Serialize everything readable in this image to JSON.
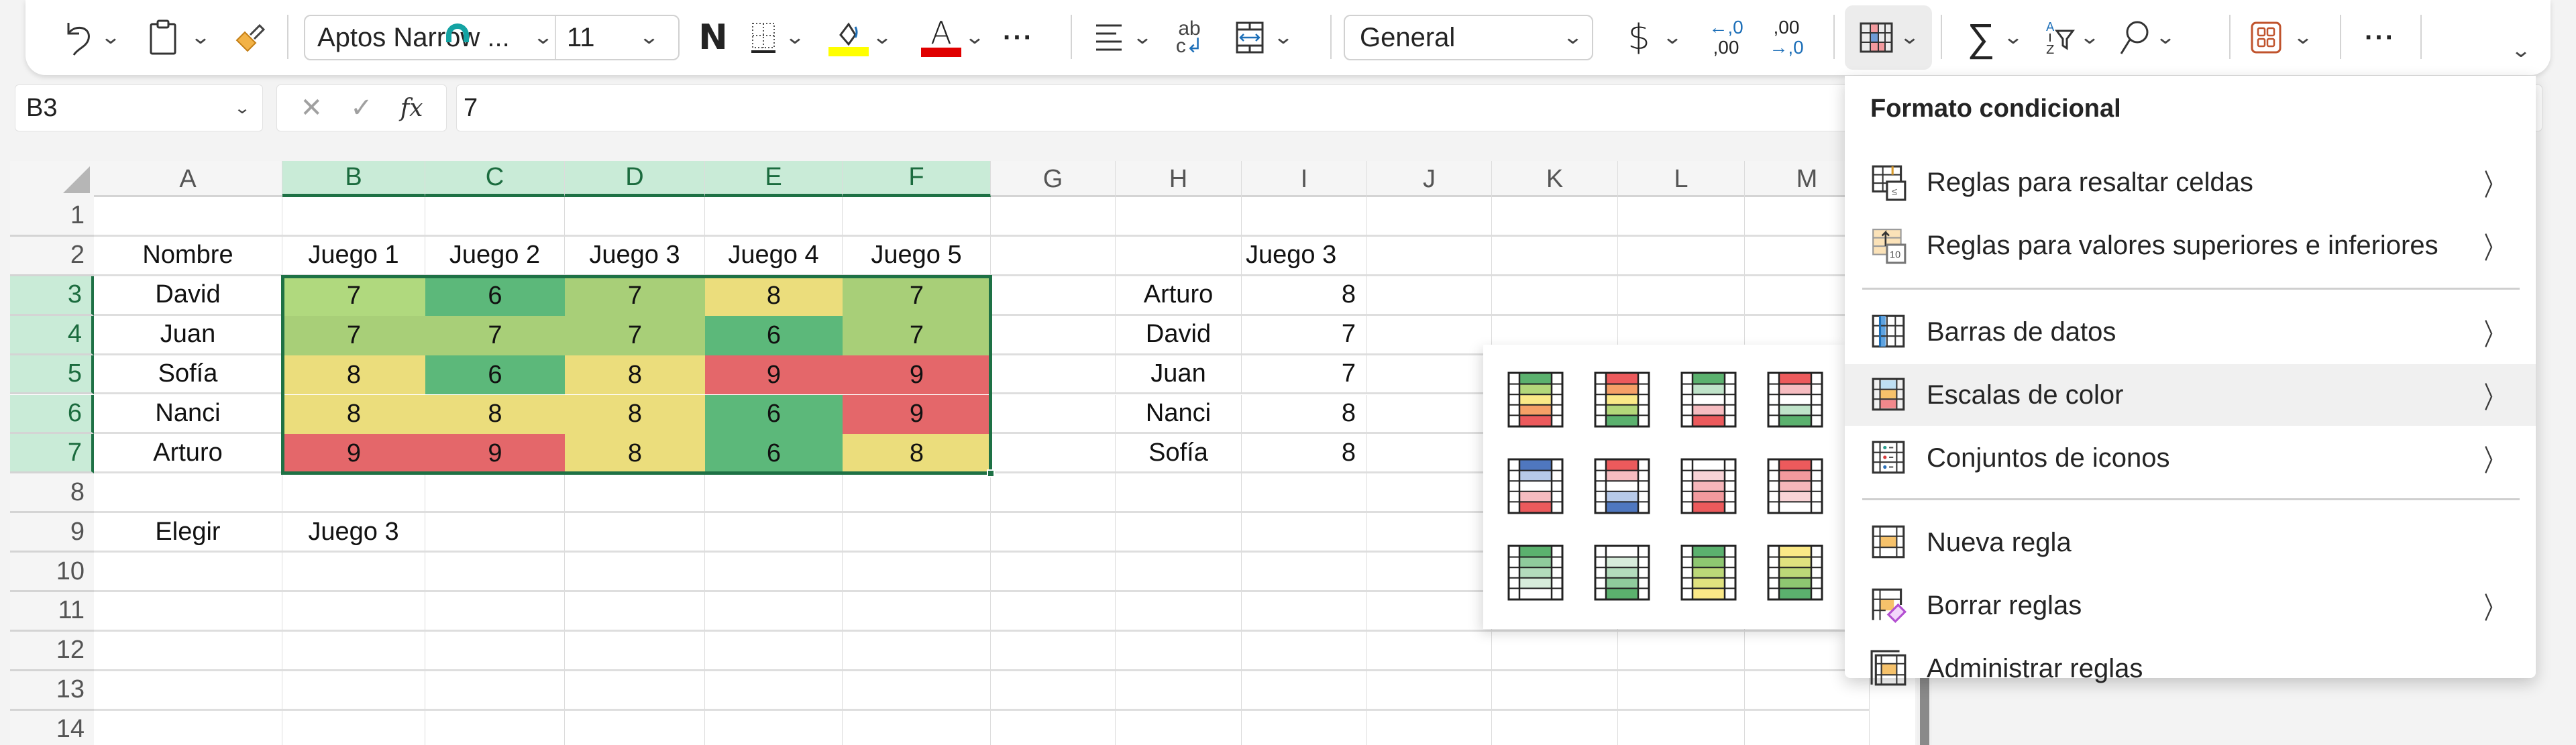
{
  "ribbon": {
    "undo_icon": "undo-icon",
    "paste_icon": "clipboard-icon",
    "format_painter_icon": "paintbrush-icon",
    "font_name": "Aptos Narrow ...",
    "font_size": "11",
    "bold_label": "N",
    "borders_icon": "borders-icon",
    "fill_color_icon": "fill-color-icon",
    "fill_color": "#FFFF00",
    "font_color_label": "A",
    "font_color": "#E00000",
    "more_label": "···",
    "align_icon": "align-icon",
    "wrap_label_top": "ab",
    "wrap_label_bottom": "c",
    "merge_icon": "merge-icon",
    "number_format": "General",
    "currency_label": "$",
    "inc_decimal_top": "←,0",
    "inc_decimal_bottom": ",00",
    "dec_decimal_top": ",00",
    "dec_decimal_bottom": "→,0",
    "cond_format_icon": "conditional-format-icon",
    "sum_label": "∑",
    "sort_filter_icon": "sort-filter-icon",
    "find_icon": "search-icon",
    "addins_icon": "addins-icon",
    "more2_label": "···",
    "expand_label": "⌄"
  },
  "formula_bar": {
    "name_box": "B3",
    "cancel_label": "✕",
    "enter_label": "✓",
    "fx_label": "fx",
    "value": "7"
  },
  "sheet": {
    "columns": [
      "A",
      "B",
      "C",
      "D",
      "E",
      "F",
      "G",
      "H",
      "I",
      "J",
      "K",
      "L",
      "M"
    ],
    "selected_columns": [
      "B",
      "C",
      "D",
      "E",
      "F"
    ],
    "rows": [
      "1",
      "2",
      "3",
      "4",
      "5",
      "6",
      "7",
      "8",
      "9",
      "10",
      "11",
      "12",
      "13",
      "14"
    ],
    "selected_rows": [
      "3",
      "4",
      "5",
      "6",
      "7"
    ],
    "active_cell": "B3",
    "header_row": [
      "Nombre",
      "Juego 1",
      "Juego 2",
      "Juego 3",
      "Juego 4",
      "Juego 5"
    ],
    "data": [
      {
        "name": "David",
        "scores": [
          "7",
          "6",
          "7",
          "8",
          "7"
        ]
      },
      {
        "name": "Juan",
        "scores": [
          "7",
          "7",
          "7",
          "6",
          "7"
        ]
      },
      {
        "name": "Sofía",
        "scores": [
          "8",
          "6",
          "8",
          "9",
          "9"
        ]
      },
      {
        "name": "Nanci",
        "scores": [
          "8",
          "8",
          "8",
          "6",
          "9"
        ]
      },
      {
        "name": "Arturo",
        "scores": [
          "9",
          "9",
          "8",
          "6",
          "8"
        ]
      }
    ],
    "scale_colors": {
      "6": "#5cb87a",
      "7": "#a8cf78",
      "8": "#ebdd7c",
      "9": "#e4676a"
    },
    "elegir_label": "Elegir",
    "elegir_value": "Juego 3",
    "lookup_header": "Juego 3",
    "lookup": [
      {
        "name": "Arturo",
        "value": "8"
      },
      {
        "name": "David",
        "value": "7"
      },
      {
        "name": "Juan",
        "value": "7"
      },
      {
        "name": "Nanci",
        "value": "8"
      },
      {
        "name": "Sofía",
        "value": "8"
      }
    ]
  },
  "menu": {
    "title": "Formato condicional",
    "items": [
      {
        "label": "Reglas para resaltar celdas",
        "icon": "highlight-rules-icon",
        "submenu": true
      },
      {
        "label": "Reglas para valores superiores e inferiores",
        "icon": "top-bottom-rules-icon",
        "submenu": true
      },
      {
        "label": "Barras de datos",
        "icon": "data-bars-icon",
        "submenu": true
      },
      {
        "label": "Escalas de color",
        "icon": "color-scales-icon",
        "submenu": true,
        "active": true
      },
      {
        "label": "Conjuntos de iconos",
        "icon": "icon-sets-icon",
        "submenu": true
      },
      {
        "label": "Nueva regla",
        "icon": "new-rule-icon",
        "submenu": false
      },
      {
        "label": "Borrar reglas",
        "icon": "clear-rules-icon",
        "submenu": true
      },
      {
        "label": "Administrar reglas",
        "icon": "manage-rules-icon",
        "submenu": false
      }
    ],
    "arrow": "〉"
  },
  "color_scales": [
    {
      "name": "green-yellow-red",
      "colors": [
        "#5bb16e",
        "#b3d77a",
        "#fbe987",
        "#f6a067",
        "#ec5a5c"
      ]
    },
    {
      "name": "red-yellow-green",
      "colors": [
        "#ec5a5c",
        "#f6a067",
        "#fbe987",
        "#b3d77a",
        "#5bb16e"
      ]
    },
    {
      "name": "green-white-red",
      "colors": [
        "#5bb16e",
        "#bfe3c9",
        "#ffffff",
        "#f6bcc0",
        "#ec5a5c"
      ]
    },
    {
      "name": "red-white-green",
      "colors": [
        "#ec5a5c",
        "#f6bcc0",
        "#ffffff",
        "#bfe3c9",
        "#5bb16e"
      ]
    },
    {
      "name": "blue-white-red",
      "colors": [
        "#4f77bf",
        "#b7cae9",
        "#ffffff",
        "#f6bcc0",
        "#ec5a5c"
      ]
    },
    {
      "name": "red-white-blue",
      "colors": [
        "#ec5a5c",
        "#f6bcc0",
        "#ffffff",
        "#b7cae9",
        "#4f77bf"
      ]
    },
    {
      "name": "white-red",
      "colors": [
        "#ffffff",
        "#f8d3d6",
        "#f6b6ba",
        "#f29a9e",
        "#ec5a5c"
      ]
    },
    {
      "name": "red-white",
      "colors": [
        "#ec5a5c",
        "#f29a9e",
        "#f6b6ba",
        "#f8d3d6",
        "#ffffff"
      ]
    },
    {
      "name": "green-white",
      "colors": [
        "#5bb16e",
        "#8fcb9c",
        "#b3dcbc",
        "#d7ecdb",
        "#ffffff"
      ]
    },
    {
      "name": "white-green",
      "colors": [
        "#ffffff",
        "#d7ecdb",
        "#b3dcbc",
        "#8fcb9c",
        "#5bb16e"
      ]
    },
    {
      "name": "green-yellow",
      "colors": [
        "#5bb16e",
        "#8ec771",
        "#bcd878",
        "#e0e27f",
        "#fbe987"
      ]
    },
    {
      "name": "yellow-green",
      "colors": [
        "#fbe987",
        "#e0e27f",
        "#bcd878",
        "#8ec771",
        "#5bb16e"
      ]
    }
  ]
}
